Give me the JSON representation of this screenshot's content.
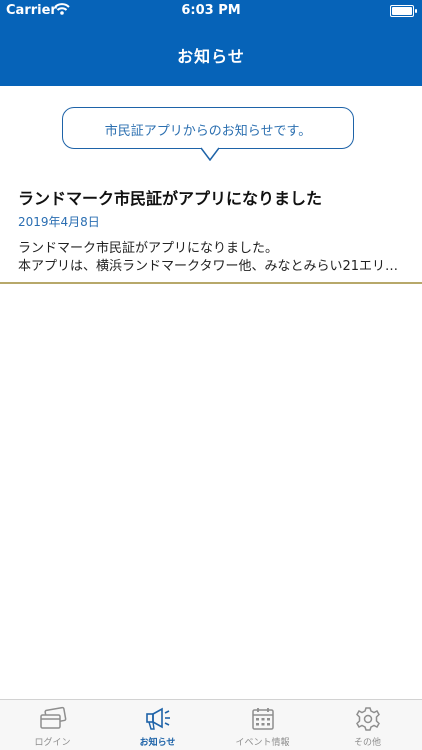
{
  "status_bar": {
    "carrier": "Carrier",
    "time": "6:03 PM"
  },
  "header": {
    "title": "お知らせ"
  },
  "notice_bubble": {
    "text": "市民証アプリからのお知らせです。"
  },
  "news": [
    {
      "title": "ランドマーク市民証がアプリになりました",
      "date": "2019年4月8日",
      "body_line1": "ランドマーク市民証がアプリになりました。",
      "body_line2": "本アプリは、横浜ランドマークタワー他、みなとみらい21エリ…"
    }
  ],
  "tabs": [
    {
      "label": "ログイン",
      "icon": "cards-icon"
    },
    {
      "label": "お知らせ",
      "icon": "megaphone-icon",
      "active": true
    },
    {
      "label": "イベント情報",
      "icon": "calendar-icon"
    },
    {
      "label": "その他",
      "icon": "gear-icon"
    }
  ],
  "colors": {
    "primary": "#0663b8",
    "accent": "#1e63a8",
    "divider": "#b7a86a"
  }
}
